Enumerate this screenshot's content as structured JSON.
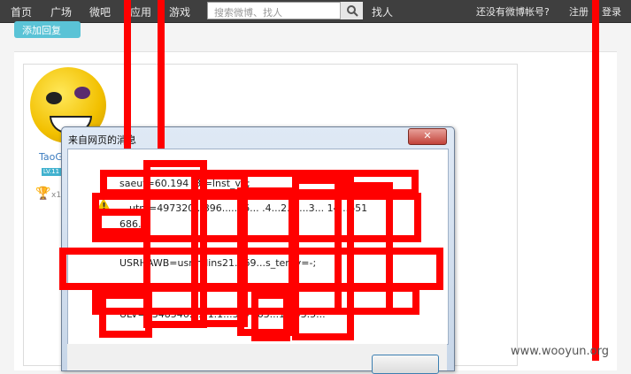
{
  "nav": {
    "items": [
      "首页",
      "广场",
      "微吧",
      "应用",
      "游戏"
    ],
    "search_placeholder": "搜索微博、找人",
    "find_people": "找人",
    "no_account": "还没有微博帐号?",
    "register": "注册",
    "login": "登录"
  },
  "page": {
    "add_reply": "添加回复",
    "user_name": "TaoG",
    "level": "LV.11",
    "trophy_count": "x1"
  },
  "dialog": {
    "title": "来自网页的消息",
    "lines": [
      "saeut=60.194                     .3                   =lnst_v1;",
      "__utm=497320...896.......6...  .4...2...  ...3... 14...651",
      "686.2",
      "USRHAWB=usrmdins21...69...s_tenry=-;",
      "ULV=1348546...3.1.1...357563...1...03.5..."
    ],
    "close_label": "✕"
  },
  "watermark": "www.wooyun.org",
  "colors": {
    "nav_bg": "#3f3f3f",
    "accent": "#5ac3d6",
    "redaction": "#ff0000"
  }
}
